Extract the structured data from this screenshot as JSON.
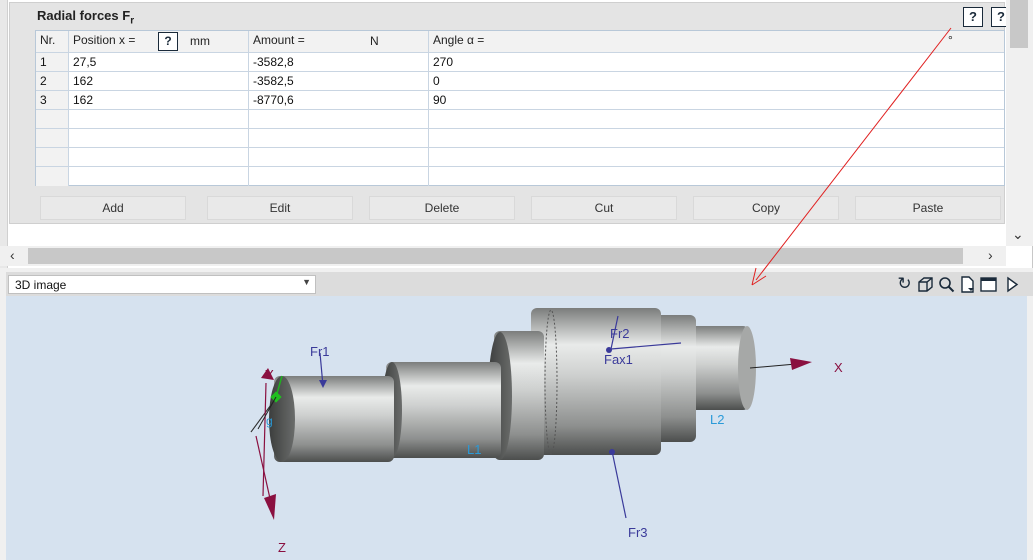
{
  "panel": {
    "title": "Radial forces F",
    "title_sub": "r",
    "help_icon_1": "?",
    "help_icon_2": "?"
  },
  "table": {
    "headers": {
      "nr": "Nr.",
      "position": "Position x =",
      "position_unit": "mm",
      "amount": "Amount =",
      "amount_unit": "N",
      "angle": "Angle α =",
      "angle_unit": "°"
    },
    "rows": [
      {
        "nr": "1",
        "position": "27,5",
        "amount": "-3582,8",
        "angle": "270"
      },
      {
        "nr": "2",
        "position": "162",
        "amount": "-3582,5",
        "angle": "0"
      },
      {
        "nr": "3",
        "position": "162",
        "amount": "-8770,6",
        "angle": "90"
      }
    ]
  },
  "buttons": {
    "add": "Add",
    "edit": "Edit",
    "delete": "Delete",
    "cut": "Cut",
    "copy": "Copy",
    "paste": "Paste"
  },
  "view": {
    "selected": "3D image"
  },
  "scene": {
    "labels": {
      "fr1": "Fr1",
      "fr2": "Fr2",
      "fr3": "Fr3",
      "fax1": "Fax1",
      "l1": "L1",
      "l2": "L2",
      "x": "X",
      "y": "Y",
      "z": "Z",
      "g": "g"
    },
    "colors": {
      "force": "#3a3a9a",
      "axis": "#8a1040",
      "bearing": "#2a9ad8",
      "shaft": "#a9aaa9",
      "annotation": "#e02020"
    }
  }
}
